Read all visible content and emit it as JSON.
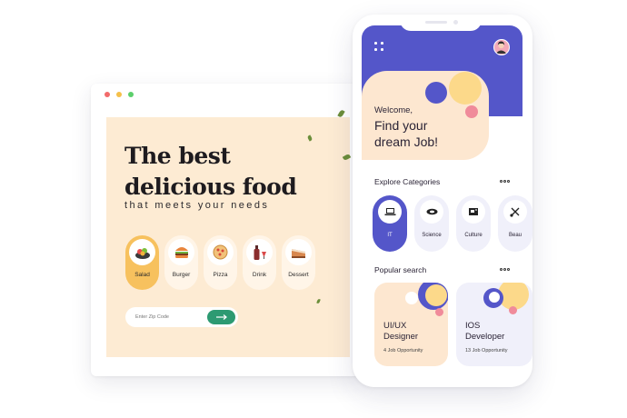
{
  "colors": {
    "primary_purple": "#5456c9",
    "peach": "#fde7d0",
    "yellow": "#f7c15e",
    "green_button": "#2d9a72",
    "pink": "#f08b9a"
  },
  "food_site": {
    "title_line1": "The best",
    "title_line2": "delicious food",
    "subtitle": "that meets your needs",
    "categories": [
      {
        "label": "Salad",
        "icon": "salad-icon"
      },
      {
        "label": "Burger",
        "icon": "burger-icon"
      },
      {
        "label": "Pizza",
        "icon": "pizza-icon"
      },
      {
        "label": "Drink",
        "icon": "drink-icon"
      },
      {
        "label": "Dessert",
        "icon": "dessert-icon"
      }
    ],
    "active_category": "Salad",
    "zip_placeholder": "Enter Zip Code",
    "submit_icon": "arrow-right-icon"
  },
  "job_app": {
    "welcome": "Welcome,",
    "headline_line1": "Find your",
    "headline_line2": "dream Job!",
    "explore_title": "Explore Categories",
    "categories": [
      {
        "label": "IT",
        "icon": "laptop-icon"
      },
      {
        "label": "Science",
        "icon": "microscope-icon"
      },
      {
        "label": "Culture",
        "icon": "book-icon"
      },
      {
        "label": "Beau",
        "icon": "scissors-icon"
      }
    ],
    "active_category": "IT",
    "popular_title": "Popular search",
    "jobs": [
      {
        "title_line1": "UI/UX",
        "title_line2": "Designer",
        "count": "4 Job Opportunity"
      },
      {
        "title_line1": "IOS",
        "title_line2": "Developer",
        "count": "13 Job Opportunity"
      }
    ]
  }
}
